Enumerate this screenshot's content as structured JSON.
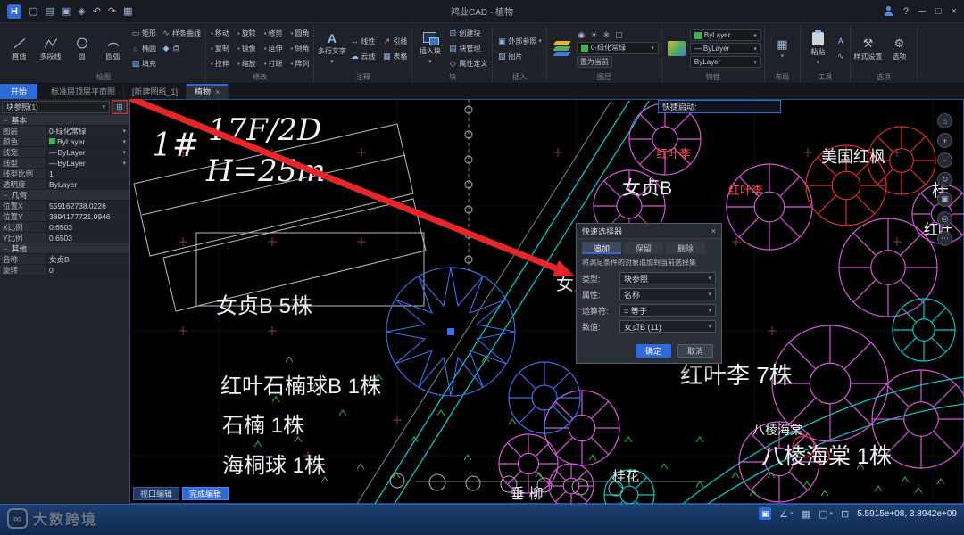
{
  "titlebar": {
    "app_title": "鸿业CAD - 植物"
  },
  "icons": {
    "caret": "▾",
    "close": "×",
    "minimize": "─",
    "maximize": "□",
    "help": "?",
    "new": "▢",
    "open": "▤",
    "save": "▣",
    "saveas": "◈",
    "undo": "↶",
    "redo": "↷",
    "print": "▦",
    "rect": "▭",
    "spline": "∿",
    "ellipse": "○",
    "point": "◆",
    "hatch": "▨",
    "mtext": "A",
    "linear": "↔",
    "leader": "↗",
    "cloud": "☁",
    "table": "▦",
    "makeblock": "⊞",
    "blockmgr": "▤",
    "attrdef": "◇",
    "xref": "▣",
    "image": "▨",
    "vis": "◉",
    "sun": "☀",
    "star": "※",
    "box": "▢",
    "style": "⚒",
    "options": "⚙",
    "grid": "▦",
    "paste_a": "A",
    "wave": "∿",
    "home": "⌂",
    "plus": "+",
    "minus": "−",
    "rotate": "↻",
    "panel": "▣",
    "target": "◎",
    "more": "⋯",
    "angle": "∠",
    "vp": "⊡",
    "quickselect": "⊞",
    "hlinechar": "—",
    "infinity": "∞"
  },
  "ribbon": {
    "draw_label": "绘图",
    "draw_big": [
      "直线",
      "多段线",
      "圆",
      "圆弧"
    ],
    "draw_small": [
      "矩形",
      "样条曲线",
      "椭圆",
      "点",
      "填充"
    ],
    "modify": {
      "label": "修改",
      "rows": [
        [
          "移动",
          "旋转",
          "修剪",
          "圆角"
        ],
        [
          "复制",
          "镜像",
          "延伸",
          "倒角"
        ],
        [
          "拉伸",
          "缩放",
          "打断",
          "阵列"
        ]
      ]
    },
    "annotate": {
      "label": "注释",
      "big": "多行文字",
      "tools": [
        "线性",
        "引线",
        "云线",
        "表格"
      ]
    },
    "block": {
      "label": "块",
      "big": "插入块",
      "tools": [
        "创建块",
        "块管理",
        "属性定义"
      ]
    },
    "insert": {
      "label": "插入",
      "tools": [
        "外部参照",
        "图片"
      ]
    },
    "layer": {
      "label": "图层",
      "dropdown": "0-绿化常绿",
      "set_current": "置为当前"
    },
    "propgrp": {
      "label": "特性",
      "values": [
        "ByLayer",
        "ByLayer",
        "ByLayer"
      ]
    },
    "layout_grp": {
      "label": "布局"
    },
    "tools_grp": {
      "label": "工具",
      "paste": "粘贴"
    },
    "options_grp": {
      "label": "选项",
      "style": "样式设置",
      "options": "选项"
    }
  },
  "tabs": {
    "start": "开始",
    "items": [
      "标准层顶层平面图",
      "[新建图纸_1]",
      "植物"
    ]
  },
  "properties": {
    "selector": "块参照(1)",
    "sections": [
      {
        "title": "基本",
        "rows": [
          {
            "label": "图层",
            "value": "0-绿化常绿"
          },
          {
            "label": "颜色",
            "value": "ByLayer"
          },
          {
            "label": "线宽",
            "value": "ByLayer"
          },
          {
            "label": "线型",
            "value": "ByLayer"
          },
          {
            "label": "线型比例",
            "value": "1"
          },
          {
            "label": "透明度",
            "value": "ByLayer"
          }
        ]
      },
      {
        "title": "几何",
        "rows": [
          {
            "label": "位置X",
            "value": "559162738.0226"
          },
          {
            "label": "位置Y",
            "value": "3894177721.0946"
          },
          {
            "label": "X比例",
            "value": "0.6503"
          },
          {
            "label": "Y比例",
            "value": "0.6503"
          }
        ]
      },
      {
        "title": "其他",
        "rows": [
          {
            "label": "名称",
            "value": "女贞B"
          },
          {
            "label": "旋转",
            "value": "0"
          }
        ]
      }
    ]
  },
  "canvas": {
    "quick_launch_label": "快捷启动:",
    "labels": {
      "u1": "1#",
      "floor": "17F/2D",
      "height": "H=25m",
      "nz_top": "女贞B",
      "hyl1": "红叶李",
      "hyl2": "红叶李",
      "mghf": "美国红枫",
      "nz5": "女贞B 5株",
      "nz_part": "女贞",
      "hysn": "红叶石楠球B 1株",
      "sn": "石楠 1株",
      "htq": "海桐球 1株",
      "hyl7": "红叶李 7株",
      "blht_s": "八棱海棠",
      "blht1": "八棱海棠 1株",
      "gh": "桂花",
      "cl": "垂 柳",
      "gui": "桂",
      "hy": "红叶"
    }
  },
  "dialog": {
    "title": "快速选择器",
    "tabs": [
      "追加",
      "保留",
      "删除"
    ],
    "description": "将满足条件的对象追加到当前选择集",
    "fields": [
      {
        "label": "类型:",
        "value": "块参照"
      },
      {
        "label": "属性:",
        "value": "名称"
      },
      {
        "label": "运算符:",
        "value": "= 等于"
      },
      {
        "label": "数值:",
        "value": "女贞B (11)"
      }
    ],
    "ok_label": "确定",
    "cancel_label": "取消"
  },
  "viewport_buttons": {
    "edit": "视口编辑",
    "done": "完成编辑"
  },
  "statusbar": {
    "coordinates": "5.5915e+08, 3.8942e+09"
  },
  "watermark": "大数跨境",
  "colors": {
    "accent": "#2f6bd8",
    "layer_green": "#3cb44a",
    "tree_blue": "#3d6ef0",
    "tree_magenta": "#d957d9",
    "tree_red": "#e03030",
    "line_cyan": "#00c8c8",
    "arrow_red": "#e8262a"
  }
}
